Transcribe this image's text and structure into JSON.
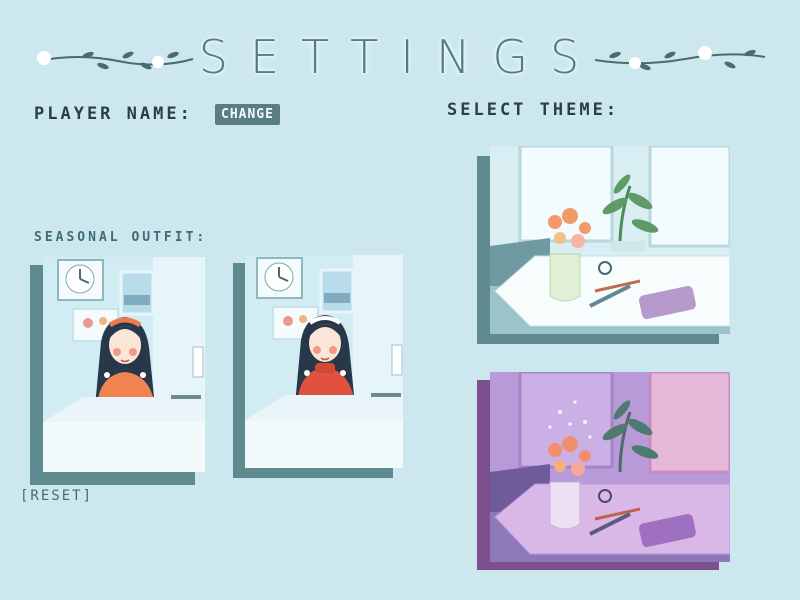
{
  "header": {
    "title": "SETTINGS"
  },
  "player": {
    "label": "PLAYER NAME:",
    "change_label": "CHANGE"
  },
  "theme": {
    "label": "SELECT THEME:",
    "options": [
      "light-theme",
      "purple-theme"
    ]
  },
  "outfit": {
    "label": "SEASONAL OUTFIT:",
    "options": [
      "orange-sweater",
      "red-sweater"
    ],
    "reset_label": "[RESET]"
  },
  "colors": {
    "background": "#cce8ee",
    "accent": "#597d83",
    "purple_accent": "#7c4f8e"
  }
}
